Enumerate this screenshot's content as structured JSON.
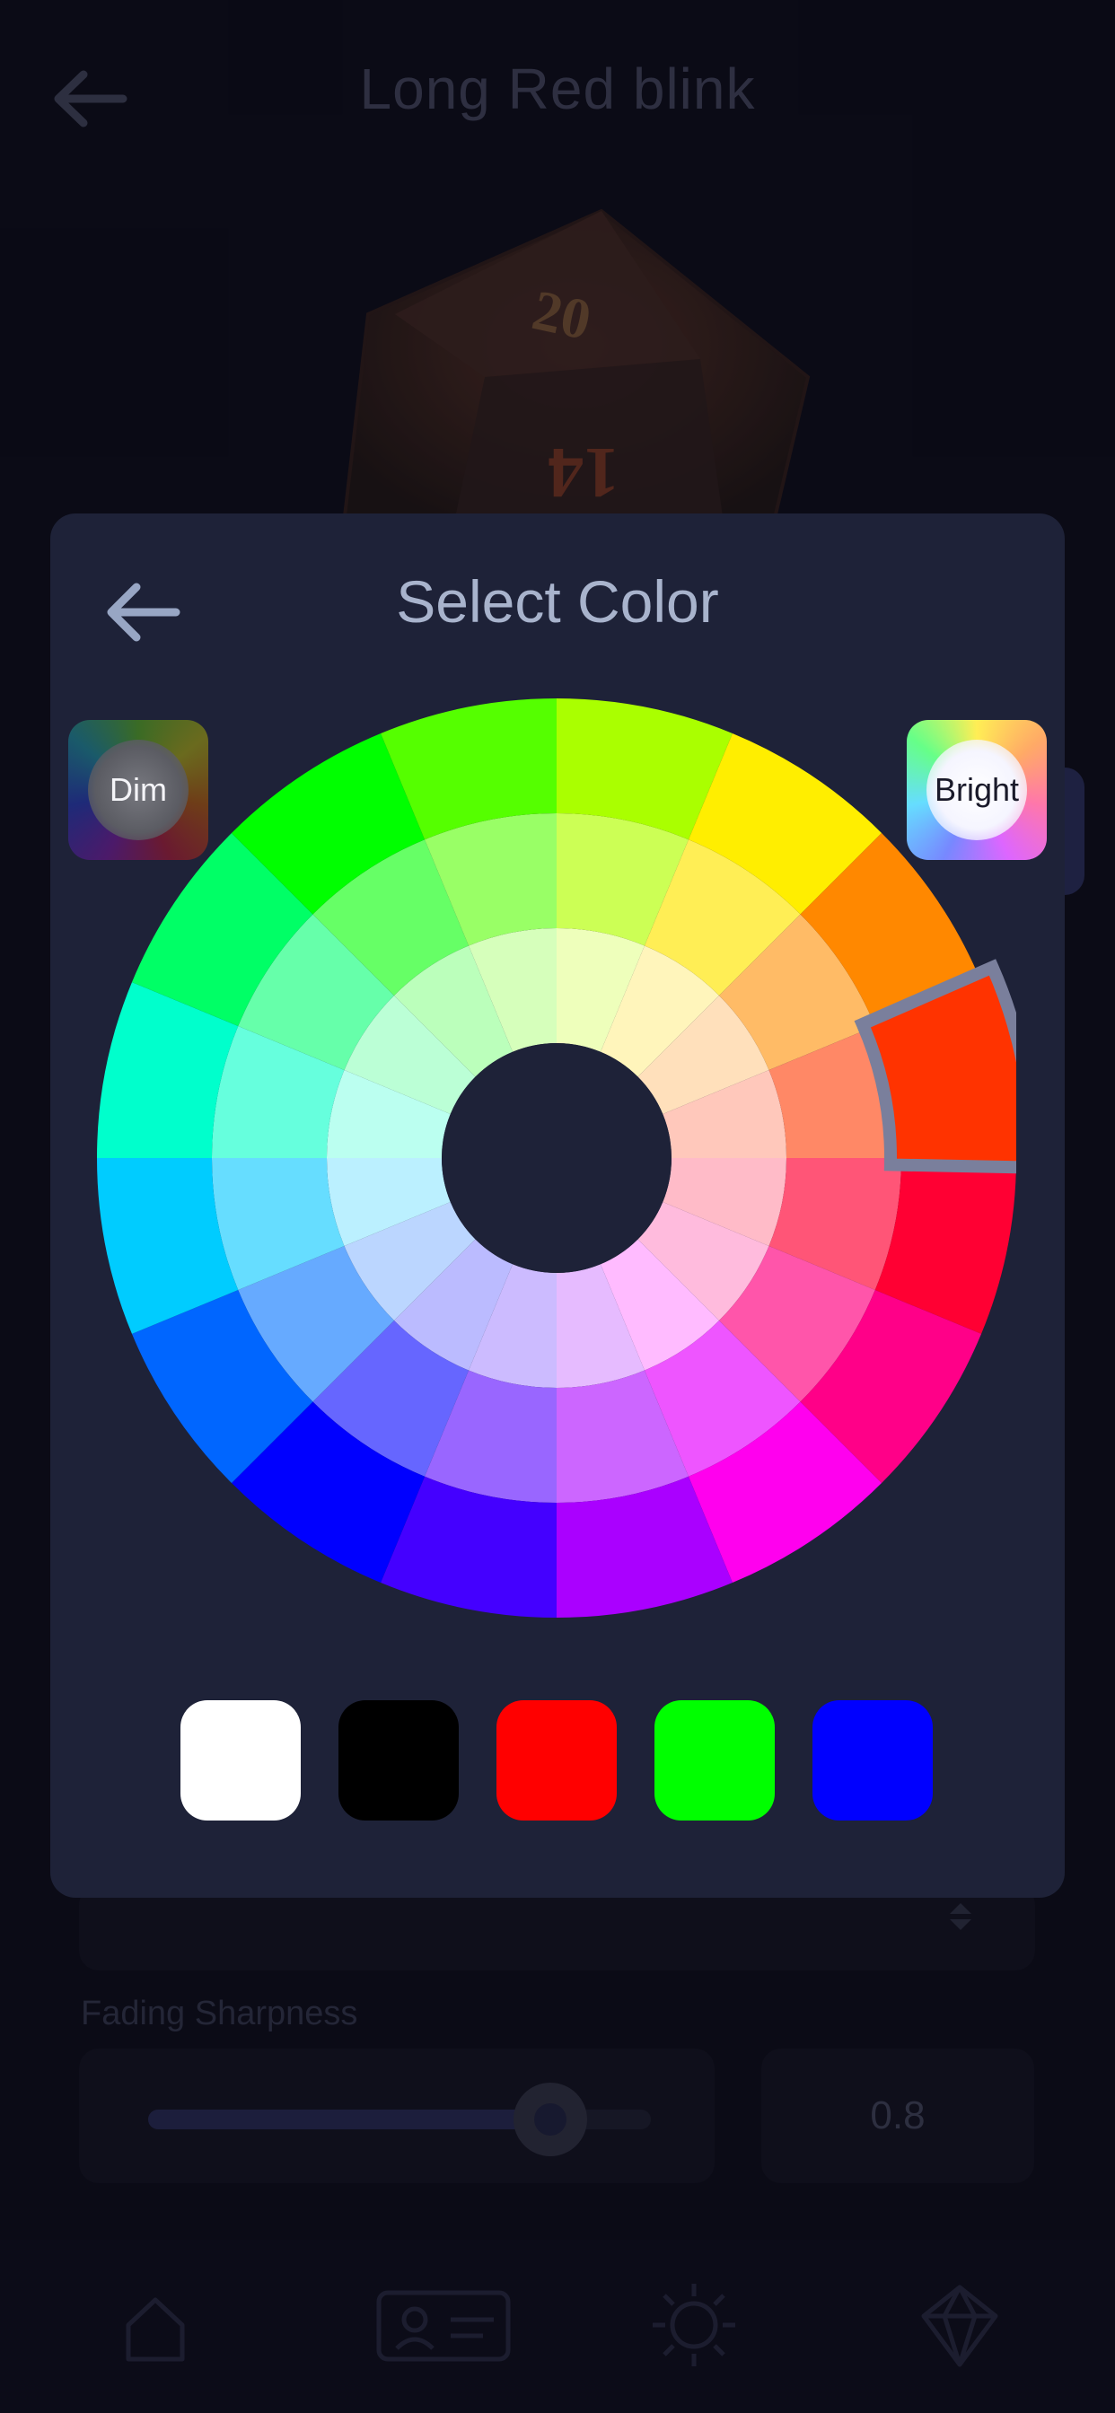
{
  "header": {
    "title": "Long Red blink",
    "back_icon": "arrow-left-icon"
  },
  "form": {
    "fading_sharpness_label": "Fading Sharpness",
    "fading_sharpness_value": "0.8",
    "fading_sharpness_fraction": 0.8
  },
  "die_numbers": {
    "top": "20",
    "front": "14"
  },
  "bottom_nav": {
    "items": [
      {
        "name": "home-icon"
      },
      {
        "name": "profile-card-icon"
      },
      {
        "name": "sun-icon"
      },
      {
        "name": "diamond-die-icon"
      }
    ]
  },
  "color_picker": {
    "title": "Select Color",
    "dim_label": "Dim",
    "bright_label": "Bright",
    "selected_color": "#ff3300",
    "selection_outline_color": "#7a7f9c",
    "hues": [
      {
        "outer": "#aaff00",
        "mid": "#ccff55",
        "inner": "#eeffbb"
      },
      {
        "outer": "#ffee00",
        "mid": "#ffee55",
        "inner": "#fff5bb"
      },
      {
        "outer": "#ff8800",
        "mid": "#ffbb66",
        "inner": "#ffe0bb"
      },
      {
        "outer": "#ff3300",
        "mid": "#ff8866",
        "inner": "#ffc8bb"
      },
      {
        "outer": "#ff0033",
        "mid": "#ff5577",
        "inner": "#ffbbc8"
      },
      {
        "outer": "#ff0088",
        "mid": "#ff55aa",
        "inner": "#ffbbdd"
      },
      {
        "outer": "#ff00ee",
        "mid": "#ee55ff",
        "inner": "#ffbbff"
      },
      {
        "outer": "#aa00ff",
        "mid": "#cc66ff",
        "inner": "#e6bbff"
      },
      {
        "outer": "#4400ff",
        "mid": "#9966ff",
        "inner": "#ccbbff"
      },
      {
        "outer": "#0000ff",
        "mid": "#6666ff",
        "inner": "#bbbbff"
      },
      {
        "outer": "#0066ff",
        "mid": "#66aaff",
        "inner": "#bbd6ff"
      },
      {
        "outer": "#00ccff",
        "mid": "#66ddff",
        "inner": "#bbf0ff"
      },
      {
        "outer": "#00ffcc",
        "mid": "#66ffdd",
        "inner": "#bbfff0"
      },
      {
        "outer": "#00ff66",
        "mid": "#66ffaa",
        "inner": "#bbffd6"
      },
      {
        "outer": "#00ff00",
        "mid": "#66ff66",
        "inner": "#bbffbb"
      },
      {
        "outer": "#55ff00",
        "mid": "#99ff66",
        "inner": "#d6ffbb"
      }
    ],
    "swatches": [
      {
        "name": "white",
        "color": "#ffffff"
      },
      {
        "name": "black",
        "color": "#000000"
      },
      {
        "name": "red",
        "color": "#ff0000"
      },
      {
        "name": "green",
        "color": "#00ff00"
      },
      {
        "name": "blue",
        "color": "#0000ff"
      }
    ]
  },
  "colors": {
    "panel": "#1e2238",
    "background": "#0c0c18"
  }
}
